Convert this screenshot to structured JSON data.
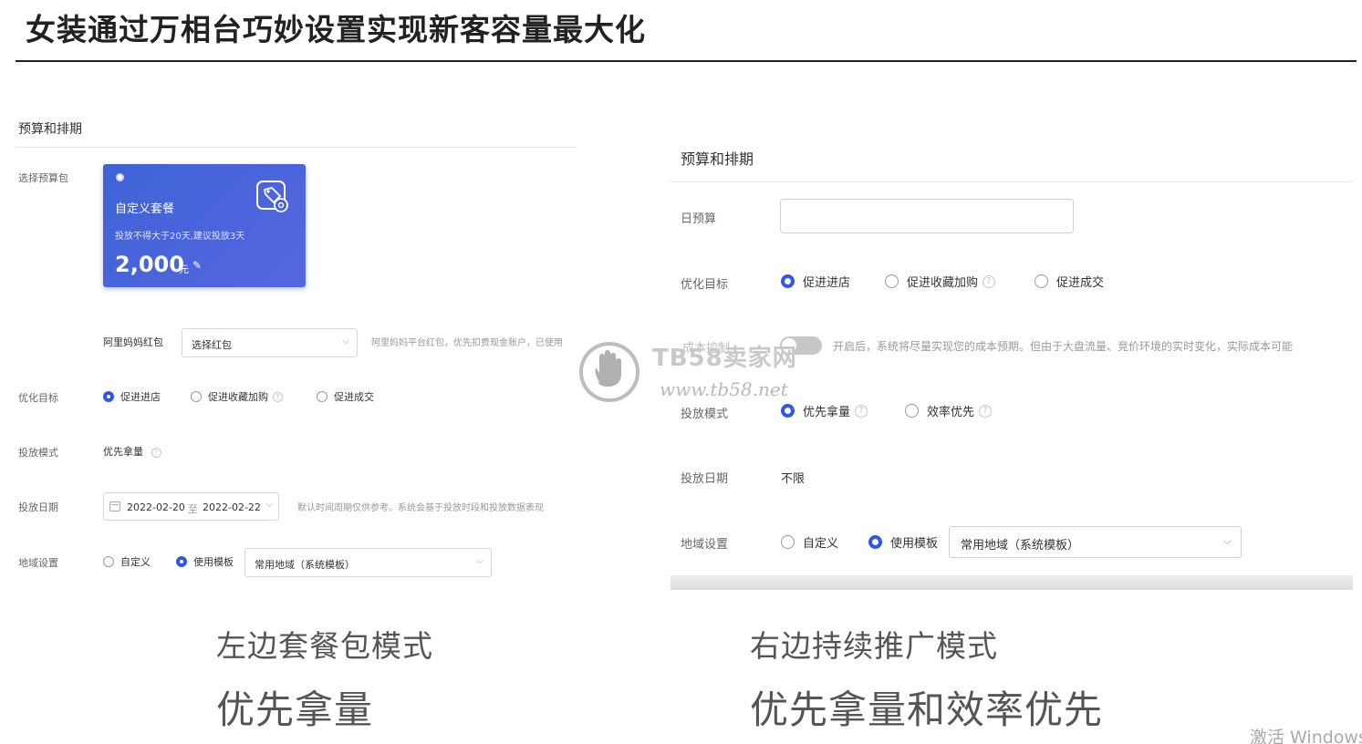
{
  "slide": {
    "title": "女装通过万相台巧妙设置实现新客容量最大化"
  },
  "left": {
    "header": "预算和排期",
    "budget_pkg_label": "选择预算包",
    "package": {
      "name": "自定义套餐",
      "desc": "投放不得大于20天,建议投放3天",
      "amount": "2,000",
      "unit": "元",
      "edit_icon": "pencil-icon",
      "badge_icon": "coupon-gear-icon"
    },
    "redpacket": {
      "label": "阿里妈妈红包",
      "placeholder": "选择红包",
      "hint": "阿里妈妈平台红包，优先扣费现金账户，已使用"
    },
    "goal": {
      "label": "优化目标",
      "options": [
        "促进进店",
        "促进收藏加购",
        "促进成交"
      ],
      "selected": 0
    },
    "mode": {
      "label": "投放模式",
      "value": "优先拿量"
    },
    "date": {
      "label": "投放日期",
      "start": "2022-02-20",
      "sep": "至",
      "end": "2022-02-22",
      "hint": "默认时间周期仅供参考。系统会基于投放时段和投放数据表现"
    },
    "region": {
      "label": "地域设置",
      "options": [
        "自定义",
        "使用模板"
      ],
      "selected": 1,
      "template": "常用地域（系统模板）"
    }
  },
  "right": {
    "header": "预算和排期",
    "daily_budget_label": "日预算",
    "goal": {
      "label": "优化目标",
      "options": [
        "促进进店",
        "促进收藏加购",
        "促进成交"
      ],
      "selected": 0
    },
    "cost_control": {
      "label": "成本控制",
      "hint": "开启后，系统将尽量实现您的成本预期。但由于大盘流量、竞价环境的实时变化，实际成本可能"
    },
    "mode": {
      "label": "投放模式",
      "options": [
        "优先拿量",
        "效率优先"
      ],
      "selected": 0
    },
    "date": {
      "label": "投放日期",
      "value": "不限"
    },
    "region": {
      "label": "地域设置",
      "options": [
        "自定义",
        "使用模板"
      ],
      "selected": 1,
      "template": "常用地域（系统模板）"
    }
  },
  "watermark": {
    "brand": "TB58卖家网",
    "url": "www.tb58.net"
  },
  "captions": {
    "left_line1": "左边套餐包模式",
    "left_line2": "优先拿量",
    "right_line1": "右边持续推广模式",
    "right_line2": "优先拿量和效率优先"
  },
  "os_watermark": "激活 Windows",
  "colors": {
    "accent": "#3155e6",
    "card_bg": "#4a5fdc"
  }
}
